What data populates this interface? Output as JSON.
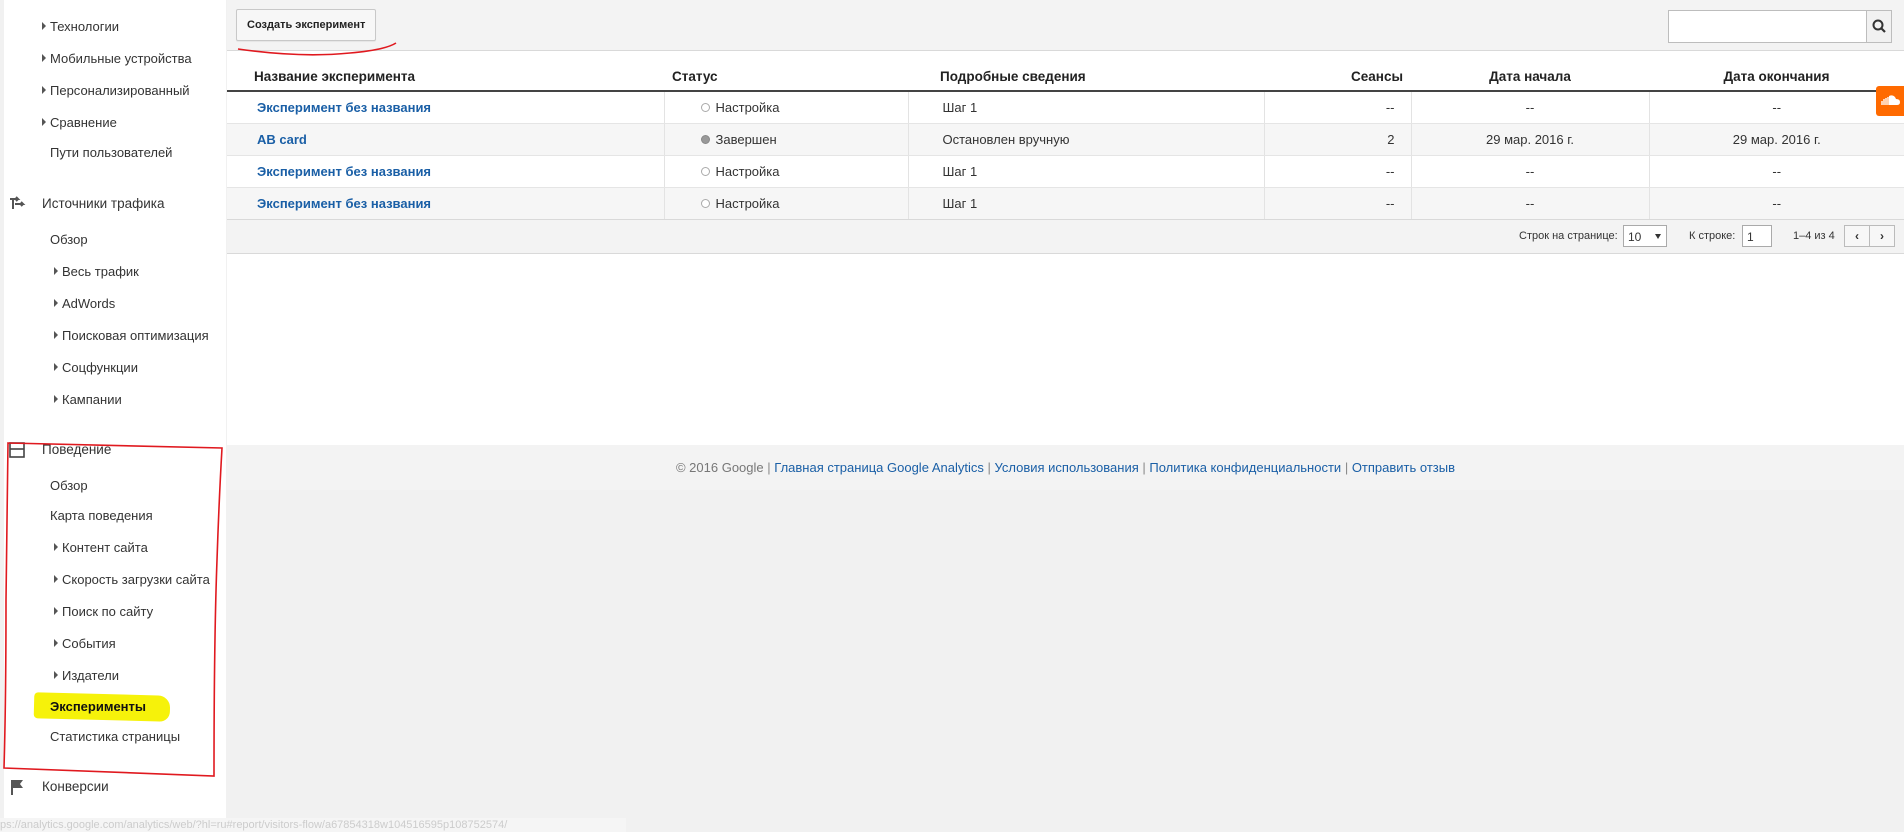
{
  "sidebar": {
    "items_top": [
      {
        "label": "Технологии",
        "arrow": true
      },
      {
        "label": "Мобильные устройства",
        "arrow": true
      },
      {
        "label": "Персонализированный",
        "arrow": true
      },
      {
        "label": "Сравнение",
        "arrow": true
      },
      {
        "label": "Пути пользователей",
        "arrow": false
      }
    ],
    "traffic": {
      "title": "Источники трафика",
      "items": [
        {
          "label": "Обзор",
          "arrow": false
        },
        {
          "label": "Весь трафик",
          "arrow": true
        },
        {
          "label": "AdWords",
          "arrow": true
        },
        {
          "label": "Поисковая оптимизация",
          "arrow": true
        },
        {
          "label": "Соцфункции",
          "arrow": true
        },
        {
          "label": "Кампании",
          "arrow": true
        }
      ]
    },
    "behavior": {
      "title": "Поведение",
      "items": [
        {
          "label": "Обзор",
          "arrow": false
        },
        {
          "label": "Карта поведения",
          "arrow": false
        },
        {
          "label": "Контент сайта",
          "arrow": true
        },
        {
          "label": "Скорость загрузки сайта",
          "arrow": true
        },
        {
          "label": "Поиск по сайту",
          "arrow": true
        },
        {
          "label": "События",
          "arrow": true
        },
        {
          "label": "Издатели",
          "arrow": true
        },
        {
          "label": "Эксперименты",
          "arrow": false,
          "active": true
        },
        {
          "label": "Статистика страницы",
          "arrow": false
        }
      ]
    },
    "conversions": {
      "title": "Конверсии"
    }
  },
  "toolbar": {
    "create_label": "Создать эксперимент",
    "search_value": ""
  },
  "table": {
    "headers": [
      "Название эксперимента",
      "Статус",
      "Подробные сведения",
      "Сеансы",
      "Дата начала",
      "Дата окончания"
    ],
    "rows": [
      {
        "name": "Эксперимент без названия",
        "status": "Настройка",
        "status_done": false,
        "details": "Шаг 1",
        "sessions": "--",
        "start": "--",
        "end": "--"
      },
      {
        "name": "AB card",
        "status": "Завершен",
        "status_done": true,
        "details": "Остановлен вручную",
        "sessions": "2",
        "start": "29 мар. 2016 г.",
        "end": "29 мар. 2016 г."
      },
      {
        "name": "Эксперимент без названия",
        "status": "Настройка",
        "status_done": false,
        "details": "Шаг 1",
        "sessions": "--",
        "start": "--",
        "end": "--"
      },
      {
        "name": "Эксперимент без названия",
        "status": "Настройка",
        "status_done": false,
        "details": "Шаг 1",
        "sessions": "--",
        "start": "--",
        "end": "--"
      }
    ]
  },
  "pager": {
    "rows_label": "Строк на странице:",
    "rows_value": "10",
    "goto_label": "К строке:",
    "goto_value": "1",
    "range": "1–4 из 4",
    "prev": "‹",
    "next": "›"
  },
  "footer": {
    "copyright": "© 2016 Google",
    "links": [
      "Главная страница Google Analytics",
      "Условия использования",
      "Политика конфиденциальности",
      "Отправить отзыв"
    ]
  },
  "status_url": "ps://analytics.google.com/analytics/web/?hl=ru#report/visitors-flow/a67854318w104516595p108752574/",
  "colors": {
    "link": "#1a5fa6",
    "highlight": "#f6f20a",
    "annotation": "#e0191f",
    "widget": "#ff6a00"
  },
  "icons": [
    "traffic-sources-icon",
    "behavior-icon",
    "conversions-flag-icon",
    "search-icon",
    "soundcloud-icon"
  ]
}
